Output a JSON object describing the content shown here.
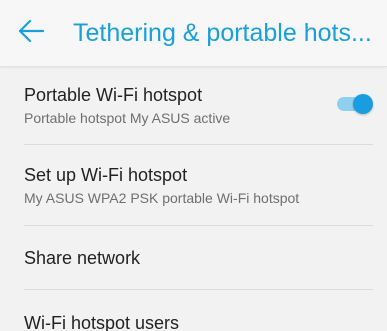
{
  "header": {
    "title": "Tethering & portable hots..."
  },
  "colors": {
    "accent": "#1aa0d8",
    "toggle_on": "#1a9de0"
  },
  "settings": [
    {
      "title": "Portable Wi-Fi hotspot",
      "subtitle": "Portable hotspot My ASUS active",
      "toggle_on": true
    },
    {
      "title": "Set up Wi-Fi hotspot",
      "subtitle": "My ASUS WPA2 PSK portable Wi-Fi hotspot"
    },
    {
      "title": "Share network"
    },
    {
      "title": "Wi-Fi hotspot users"
    }
  ]
}
